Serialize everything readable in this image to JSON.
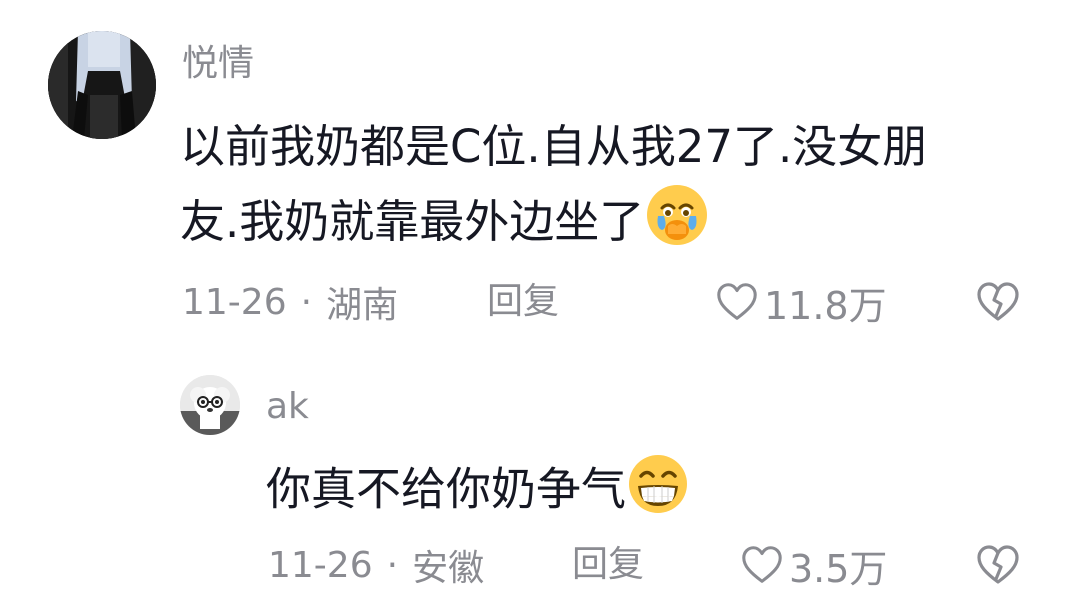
{
  "comments": [
    {
      "username": "悦情",
      "content_lines": [
        "以前我奶都是C位.自从我27了.没女朋",
        "友.我奶就靠最外边坐了"
      ],
      "emoji": "crying-emoji",
      "date": "11-26",
      "separator": "·",
      "location": "湖南",
      "reply_label": "回复",
      "likes": "11.8万"
    },
    {
      "username": "ak",
      "content_lines": [
        "你真不给你奶争气"
      ],
      "emoji": "grinning-emoji",
      "date": "11-26",
      "separator": "·",
      "location": "安徽",
      "reply_label": "回复",
      "likes": "3.5万"
    }
  ],
  "colors": {
    "text": "#161823",
    "muted": "#8a8b91",
    "background": "#ffffff"
  }
}
